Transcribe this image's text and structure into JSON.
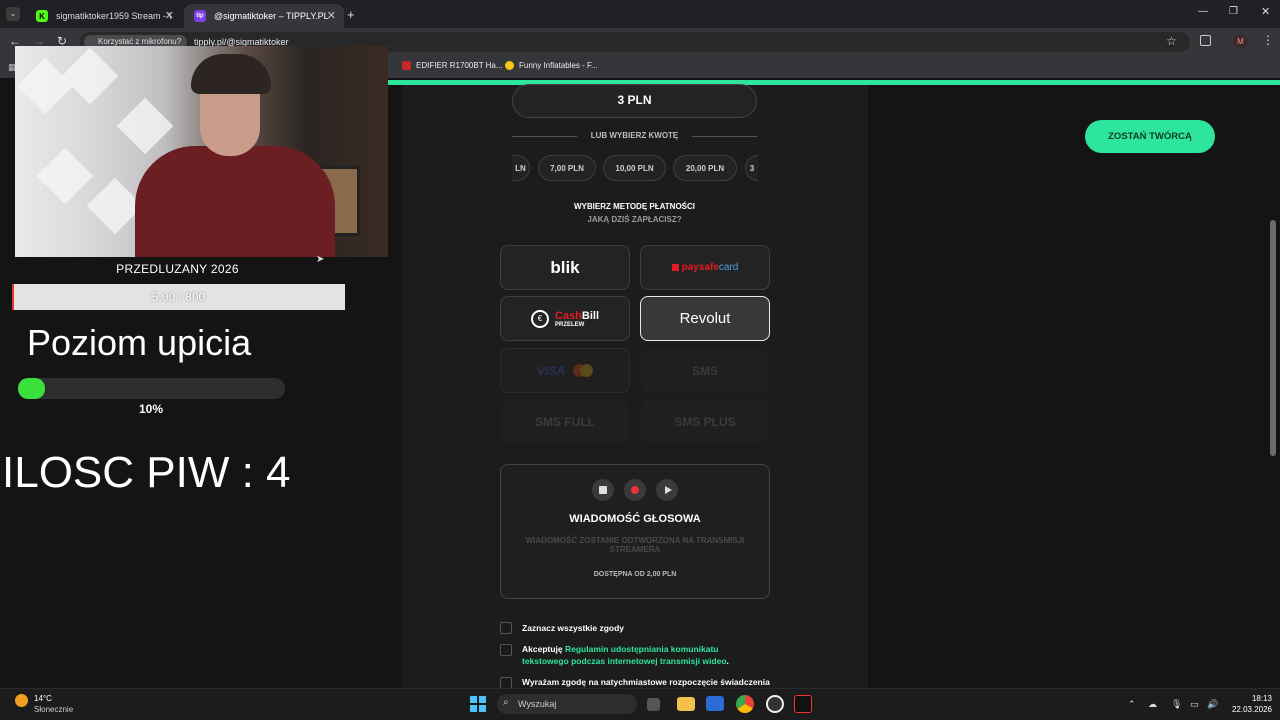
{
  "browser": {
    "tabs": [
      {
        "title": "sigmatiktoker1959 Stream - Wa",
        "favicon": "K"
      },
      {
        "title": "@sigmatiktoker – TIPPLY.PL",
        "favicon": "tip"
      }
    ],
    "mic_chip": "Korzystać z mikrofonu?",
    "url": "tipply.pl/@sigmatiktoker",
    "profile_initial": "M",
    "bookmarks": [
      "EDIFIER R1700BT Ha...",
      "Funny Inflatables - F..."
    ]
  },
  "overlay": {
    "extension_title": "PRZEDLUZANY 2026",
    "goal_text": "5.00 / 800",
    "drunk_title": "Poziom upicia",
    "drunk_level": 0.1,
    "drunk_pct": "10%",
    "beer_count": "ILOSC PIW : 4"
  },
  "form": {
    "amount": "3 PLN",
    "or_choose": "LUB WYBIERZ KWOTĘ",
    "amount_chips": [
      "LN",
      "7,00 PLN",
      "10,00 PLN",
      "20,00 PLN",
      "3"
    ],
    "pay_title": "WYBIERZ METODĘ PŁATNOŚCI",
    "pay_sub": "JAKĄ DZIŚ ZAPŁACISZ?",
    "methods": {
      "blik": "blik",
      "paysafe_a": "paysafe",
      "paysafe_b": "card",
      "cashbill_a": "Cash",
      "cashbill_b": "Bill",
      "cashbill_sub": "PRZELEW",
      "revolut": "Revolut",
      "visa": "VISA",
      "sms": "SMS",
      "sms_full": "SMS FULL",
      "sms_plus": "SMS PLUS"
    },
    "voice": {
      "title": "WIADOMOŚĆ GŁOSOWA",
      "desc": "WIADOMOŚĆ ZOSTANIE ODTWORZONA NA TRANSMISJI STREAMERA",
      "avail": "DOSTĘPNA OD 2,00 PLN"
    },
    "consents": {
      "all": "Zaznacz wszystkie zgody",
      "accept_prefix": "Akceptuję ",
      "accept_link": "Regulamin udostępniania komunikatu tekstowego podczas internetowej transmisji wideo",
      "accept_suffix": ".",
      "immediate": "Wyrażam zgodę na natychmiastowe rozpoczęcie świadczenia"
    },
    "creator_button": "ZOSTAŃ TWÓRCĄ"
  },
  "taskbar": {
    "temp": "14°C",
    "condition": "Słonecznie",
    "search": "Wyszukaj",
    "time": "18:13",
    "date": "22.03.2026"
  },
  "colors": {
    "accent": "#2ee59d",
    "blik": "#ffffff",
    "paysafe": "#e31b23",
    "cashbill": "#e31b23"
  }
}
